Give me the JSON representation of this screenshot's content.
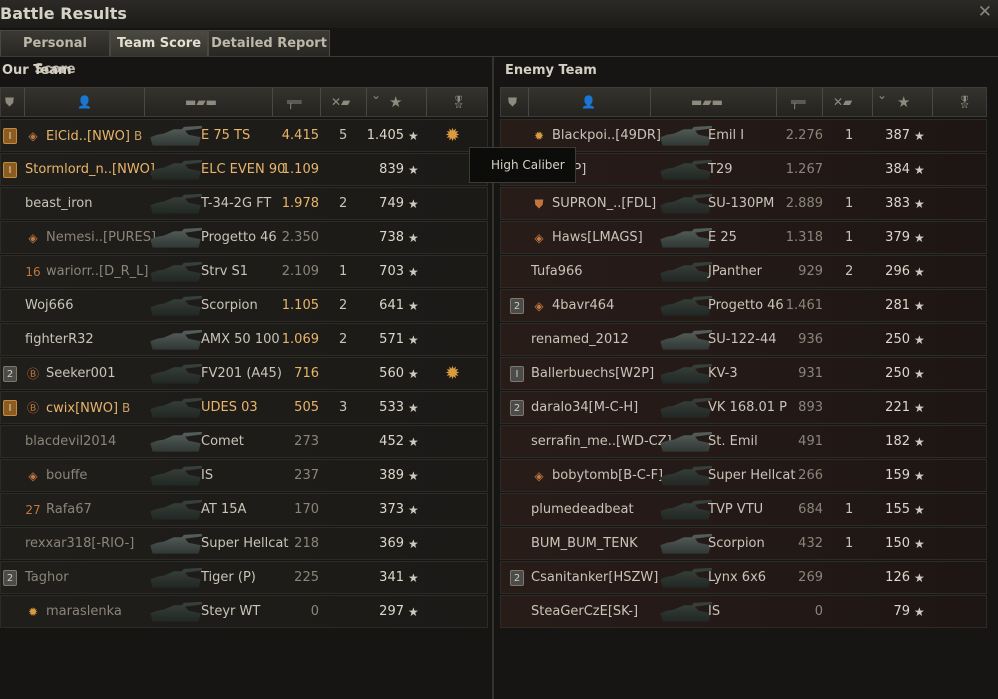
{
  "window": {
    "title": "Battle Results",
    "close_label": "✕"
  },
  "tabs": [
    {
      "label": "Personal Score",
      "active": false
    },
    {
      "label": "Team Score",
      "active": true
    },
    {
      "label": "Detailed Report",
      "active": false
    }
  ],
  "tooltip": "High Caliber",
  "columns": [
    "platoon",
    "player",
    "vehicle",
    "damage",
    "kills",
    "experience",
    "medals"
  ],
  "colors": {
    "highlight": "#e8b56a",
    "normal": "#c9c4b7",
    "dim": "#8b8579",
    "player": "#e8b56a"
  },
  "our_team": {
    "title": "Our Team",
    "rows": [
      {
        "badge": "I",
        "badge_gold": true,
        "icon": "diamond-icon",
        "name": "ElCid..[NWO]",
        "clan": "B",
        "vehicle": "E 75 TS",
        "damage": "4.415",
        "kills": "5",
        "xp": "1.405",
        "medal": "high-caliber-medal-icon",
        "highlight": true,
        "dim": false
      },
      {
        "badge": "I",
        "badge_gold": true,
        "icon": "",
        "name": "Stormlord_n..[NWO]",
        "clan": "",
        "vehicle": "ELC EVEN 90",
        "damage": "1.109",
        "kills": "",
        "xp": "839",
        "medal": "",
        "highlight": true,
        "dim": false
      },
      {
        "badge": "",
        "badge_gold": false,
        "icon": "",
        "name": "beast_iron",
        "clan": "",
        "vehicle": "T-34-2G FT",
        "damage": "1.978",
        "kills": "2",
        "xp": "749",
        "medal": "",
        "highlight": false,
        "dim": false
      },
      {
        "badge": "",
        "badge_gold": false,
        "icon": "diamond-icon",
        "name": "Nemesi..[PURES]",
        "clan": "",
        "vehicle": "Progetto 46",
        "damage": "2.350",
        "kills": "",
        "xp": "738",
        "medal": "",
        "highlight": false,
        "dim": true
      },
      {
        "badge": "",
        "badge_gold": false,
        "icon": "rank-16-icon",
        "name": "wariorr..[D_R_L]",
        "clan": "",
        "vehicle": "Strv S1",
        "damage": "2.109",
        "kills": "1",
        "xp": "703",
        "medal": "",
        "highlight": false,
        "dim": true
      },
      {
        "badge": "",
        "badge_gold": false,
        "icon": "",
        "name": "Woj666",
        "clan": "",
        "vehicle": "Scorpion",
        "damage": "1.105",
        "kills": "2",
        "xp": "641",
        "medal": "",
        "highlight": false,
        "dim": false
      },
      {
        "badge": "",
        "badge_gold": false,
        "icon": "",
        "name": "fighterR32",
        "clan": "",
        "vehicle": "AMX 50 100",
        "damage": "1.069",
        "kills": "2",
        "xp": "571",
        "medal": "",
        "highlight": false,
        "dim": false
      },
      {
        "badge": "2",
        "badge_gold": false,
        "icon": "b-icon",
        "name": "Seeker001",
        "clan": "",
        "vehicle": "FV201 (A45)",
        "damage": "716",
        "kills": "",
        "xp": "560",
        "medal": "medal-icon",
        "highlight": false,
        "dim": false
      },
      {
        "badge": "I",
        "badge_gold": true,
        "icon": "b-icon",
        "name": "cwix[NWO]",
        "clan": "B",
        "vehicle": "UDES 03",
        "damage": "505",
        "kills": "3",
        "xp": "533",
        "medal": "",
        "highlight": true,
        "dim": false
      },
      {
        "badge": "",
        "badge_gold": false,
        "icon": "",
        "name": "blacdevil2014",
        "clan": "",
        "vehicle": "Comet",
        "damage": "273",
        "kills": "",
        "xp": "452",
        "medal": "",
        "highlight": false,
        "dim": true
      },
      {
        "badge": "",
        "badge_gold": false,
        "icon": "diamond-icon",
        "name": "bouffe",
        "clan": "",
        "vehicle": "IS",
        "damage": "237",
        "kills": "",
        "xp": "389",
        "medal": "",
        "highlight": false,
        "dim": true
      },
      {
        "badge": "",
        "badge_gold": false,
        "icon": "rank-27-icon",
        "name": "Rafa67",
        "clan": "",
        "vehicle": "AT 15A",
        "damage": "170",
        "kills": "",
        "xp": "373",
        "medal": "",
        "highlight": false,
        "dim": true
      },
      {
        "badge": "",
        "badge_gold": false,
        "icon": "",
        "name": "rexxar318[-RIO-]",
        "clan": "",
        "vehicle": "Super Hellcat",
        "damage": "218",
        "kills": "",
        "xp": "369",
        "medal": "",
        "highlight": false,
        "dim": true
      },
      {
        "badge": "2",
        "badge_gold": false,
        "icon": "",
        "name": "Taghor",
        "clan": "",
        "vehicle": "Tiger (P)",
        "damage": "225",
        "kills": "",
        "xp": "341",
        "medal": "",
        "highlight": false,
        "dim": true
      },
      {
        "badge": "",
        "badge_gold": false,
        "icon": "medal-icon",
        "name": "maraslenka",
        "clan": "",
        "vehicle": "Steyr WT",
        "damage": "0",
        "kills": "",
        "xp": "297",
        "medal": "",
        "highlight": false,
        "dim": true
      }
    ]
  },
  "enemy_team": {
    "title": "Enemy Team",
    "rows": [
      {
        "badge": "",
        "icon": "medal-icon",
        "name": "Blackpoi..[49DR]",
        "vehicle": "Emil I",
        "damage": "2.276",
        "kills": "1",
        "xp": "387"
      },
      {
        "badge": "",
        "icon": "",
        "name": "en[W2P]",
        "vehicle": "T29",
        "damage": "1.267",
        "kills": "",
        "xp": "384"
      },
      {
        "badge": "",
        "icon": "shield-icon",
        "name": "SUPRON_..[FDL]",
        "vehicle": "SU-130PM",
        "damage": "2.889",
        "kills": "1",
        "xp": "383"
      },
      {
        "badge": "",
        "icon": "diamond-icon",
        "name": "Haws[LMAGS]",
        "vehicle": "E 25",
        "damage": "1.318",
        "kills": "1",
        "xp": "379"
      },
      {
        "badge": "",
        "icon": "",
        "name": "Tufa966",
        "vehicle": "JPanther",
        "damage": "929",
        "kills": "2",
        "xp": "296"
      },
      {
        "badge": "2",
        "icon": "diamond-icon",
        "name": "4bavr464",
        "vehicle": "Progetto 46",
        "damage": "1.461",
        "kills": "",
        "xp": "281"
      },
      {
        "badge": "",
        "icon": "",
        "name": "renamed_2012",
        "vehicle": "SU-122-44",
        "damage": "936",
        "kills": "",
        "xp": "250"
      },
      {
        "badge": "I",
        "icon": "",
        "name": "Ballerbuechs[W2P]",
        "vehicle": "KV-3",
        "damage": "931",
        "kills": "",
        "xp": "250"
      },
      {
        "badge": "2",
        "icon": "",
        "name": "daralo34[M-C-H]",
        "vehicle": "VK 168.01 P",
        "damage": "893",
        "kills": "",
        "xp": "221"
      },
      {
        "badge": "",
        "icon": "",
        "name": "serrafin_me..[WD-CZ]",
        "vehicle": "St. Emil",
        "damage": "491",
        "kills": "",
        "xp": "182"
      },
      {
        "badge": "",
        "icon": "diamond-icon",
        "name": "bobytomb[B-C-F]",
        "vehicle": "Super Hellcat",
        "damage": "266",
        "kills": "",
        "xp": "159"
      },
      {
        "badge": "",
        "icon": "",
        "name": "plumedeadbeat",
        "vehicle": "TVP VTU",
        "damage": "684",
        "kills": "1",
        "xp": "155"
      },
      {
        "badge": "",
        "icon": "",
        "name": "BUM_BUM_TENK",
        "vehicle": "Scorpion",
        "damage": "432",
        "kills": "1",
        "xp": "150"
      },
      {
        "badge": "2",
        "icon": "",
        "name": "Csanitanker[HSZW]",
        "vehicle": "Lynx 6x6",
        "damage": "269",
        "kills": "",
        "xp": "126"
      },
      {
        "badge": "",
        "icon": "",
        "name": "SteaGerCzE[SK-]",
        "vehicle": "IS",
        "damage": "0",
        "kills": "",
        "xp": "79"
      }
    ]
  }
}
